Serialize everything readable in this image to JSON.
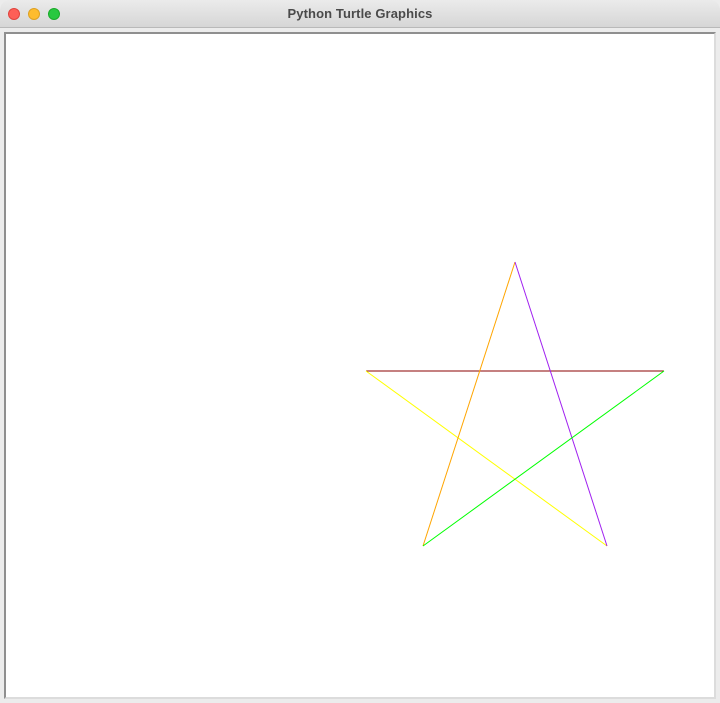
{
  "window": {
    "title": "Python Turtle Graphics",
    "controls": {
      "close_icon": "close-icon",
      "minimize_icon": "minimize-icon",
      "zoom_icon": "zoom-icon"
    }
  },
  "canvas": {
    "background": "#ffffff",
    "star_segments": [
      {
        "name": "star-segment-top",
        "color": "#8b0000"
      },
      {
        "name": "star-segment-left",
        "color": "#ffff00"
      },
      {
        "name": "star-segment-upstroke",
        "color": "#ffa500"
      },
      {
        "name": "star-segment-downstroke",
        "color": "#a020f0"
      },
      {
        "name": "star-segment-right",
        "color": "#00ff00"
      }
    ]
  }
}
